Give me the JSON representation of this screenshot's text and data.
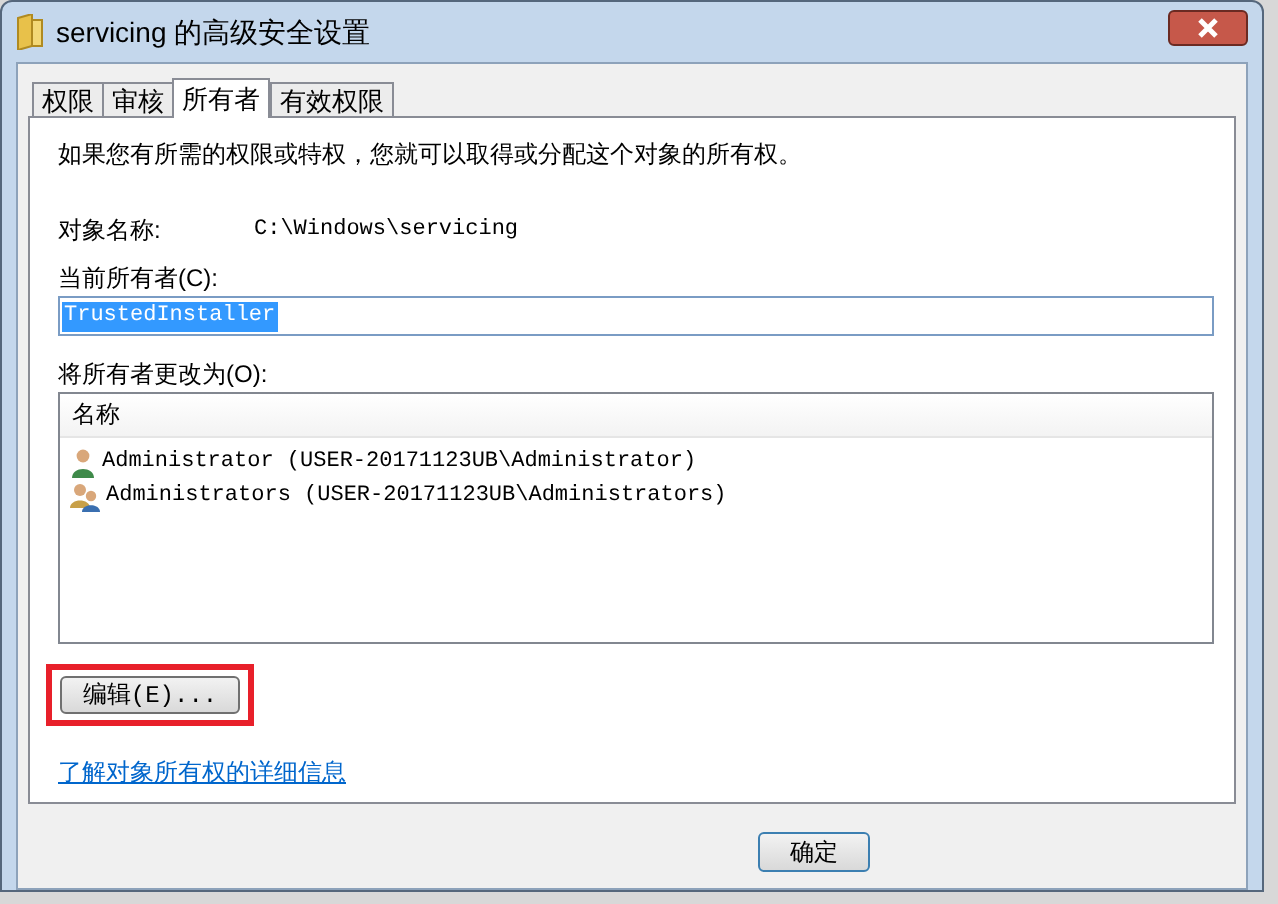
{
  "window": {
    "title": "servicing 的高级安全设置"
  },
  "tabs": [
    {
      "label": "权限",
      "selected": false
    },
    {
      "label": "审核",
      "selected": false
    },
    {
      "label": "所有者",
      "selected": true
    },
    {
      "label": "有效权限",
      "selected": false
    }
  ],
  "description": "如果您有所需的权限或特权，您就可以取得或分配这个对象的所有权。",
  "object_name": {
    "label": "对象名称:",
    "value": "C:\\Windows\\servicing"
  },
  "current_owner": {
    "label": "当前所有者(C):",
    "value": "TrustedInstaller",
    "selected": true
  },
  "change_owner": {
    "label": "将所有者更改为(O):",
    "columns": [
      "名称"
    ],
    "rows": [
      {
        "kind": "user",
        "name": "Administrator (USER-20171123UB\\Administrator)"
      },
      {
        "kind": "group",
        "name": "Administrators (USER-20171123UB\\Administrators)"
      }
    ]
  },
  "edit_button": {
    "label": "编辑(E)...",
    "highlighted": true
  },
  "link": "了解对象所有权的详细信息",
  "buttons": [
    "确定"
  ]
}
